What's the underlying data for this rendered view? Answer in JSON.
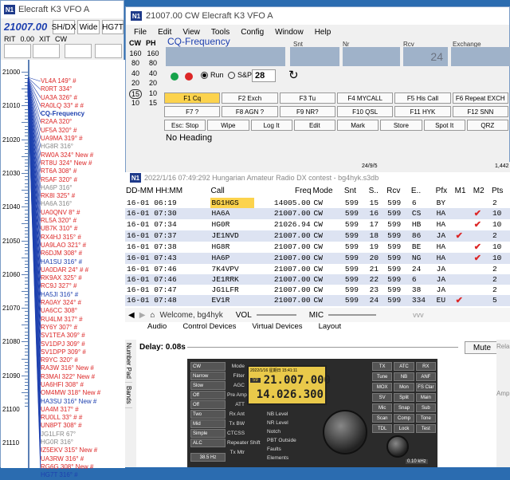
{
  "bandmap": {
    "title": "Elecraft K3 VFO A",
    "freq": "21007.00",
    "buttons": [
      "SH/DX",
      "Wide",
      "HG7T"
    ],
    "rit_label": "RIT",
    "rit_value": "0.00",
    "xit_label": "XIT",
    "xit_value": "CW",
    "scale_labels": [
      "21000",
      "21010",
      "21020",
      "21030",
      "21040",
      "21050",
      "21060",
      "21070",
      "21080",
      "21090",
      "21100",
      "21110"
    ],
    "spots": [
      {
        "text": "VL4A 149° #",
        "color": "#dc2626"
      },
      {
        "text": "R0RT 334°",
        "color": "#dc2626"
      },
      {
        "text": "UA3A 326° #",
        "color": "#dc2626"
      },
      {
        "text": "RA0LQ 33° # #",
        "color": "#dc2626"
      },
      {
        "text": "CQ-Frequency",
        "color": "#1e40af"
      },
      {
        "text": "R2AA 320°",
        "color": "#dc2626"
      },
      {
        "text": "UF5A 320° #",
        "color": "#dc2626"
      },
      {
        "text": "UA9MA 319° #",
        "color": "#dc2626"
      },
      {
        "text": "HG8R 316°",
        "color": "#888888"
      },
      {
        "text": "RW0A 324° New #",
        "color": "#dc2626"
      },
      {
        "text": "RT8U 324° New #",
        "color": "#dc2626"
      },
      {
        "text": "RT6A 308° #",
        "color": "#dc2626"
      },
      {
        "text": "R5AF 320° #",
        "color": "#dc2626"
      },
      {
        "text": "HA6P 316°",
        "color": "#888888"
      },
      {
        "text": "RK8I 325° #",
        "color": "#dc2626"
      },
      {
        "text": "HA6A 316°",
        "color": "#888888"
      },
      {
        "text": "UA0QNV 8° #",
        "color": "#dc2626"
      },
      {
        "text": "RL5A 320° #",
        "color": "#dc2626"
      },
      {
        "text": "UB7K 310° #",
        "color": "#dc2626"
      },
      {
        "text": "RX4HJ 315° #",
        "color": "#dc2626"
      },
      {
        "text": "UA9LAO 321° #",
        "color": "#dc2626"
      },
      {
        "text": "R6DJM 308° #",
        "color": "#dc2626"
      },
      {
        "text": "HA1SU 316° #",
        "color": "#1e40af"
      },
      {
        "text": "UA0DAR 24° # #",
        "color": "#dc2626"
      },
      {
        "text": "RK9AX 325° #",
        "color": "#dc2626"
      },
      {
        "text": "RC9J 327° #",
        "color": "#dc2626"
      },
      {
        "text": "HA5JI 316° #",
        "color": "#1e40af"
      },
      {
        "text": "RA0AY 324° #",
        "color": "#dc2626"
      },
      {
        "text": "UA6CC 308°",
        "color": "#dc2626"
      },
      {
        "text": "RU4LM 317° #",
        "color": "#dc2626"
      },
      {
        "text": "RY6Y 307° #",
        "color": "#dc2626"
      },
      {
        "text": "SV1TEA 309° #",
        "color": "#dc2626"
      },
      {
        "text": "SV1DPJ 309° #",
        "color": "#dc2626"
      },
      {
        "text": "SV1DPP 309° #",
        "color": "#dc2626"
      },
      {
        "text": "R9YC 320° #",
        "color": "#dc2626"
      },
      {
        "text": "RA3W 316° New #",
        "color": "#dc2626"
      },
      {
        "text": "R3MAI 322° New #",
        "color": "#dc2626"
      },
      {
        "text": "UA6HFI 308° #",
        "color": "#dc2626"
      },
      {
        "text": "OM4MW 318° New #",
        "color": "#dc2626"
      },
      {
        "text": "HA3SU 316° New #",
        "color": "#1e40af"
      },
      {
        "text": "UA4M 317° #",
        "color": "#dc2626"
      },
      {
        "text": "RU0LL 33° # #",
        "color": "#dc2626"
      },
      {
        "text": "UN8PT 308° #",
        "color": "#dc2626"
      },
      {
        "text": "JG1LFR 67°",
        "color": "#888888"
      },
      {
        "text": "HG0R 316°",
        "color": "#888888"
      },
      {
        "text": "IZ5EKV 315° New #",
        "color": "#dc2626"
      },
      {
        "text": "UA3RW 316° #",
        "color": "#dc2626"
      },
      {
        "text": "RG6G 308° New #",
        "color": "#dc2626"
      },
      {
        "text": "HG7T 316° #",
        "color": "#1e40af"
      }
    ]
  },
  "main": {
    "title": "21007.00 CW Elecraft K3 VFO A",
    "menu": [
      "File",
      "Edit",
      "View",
      "Tools",
      "Config",
      "Window",
      "Help"
    ],
    "cw_label": "CW",
    "ph_label": "PH",
    "wpm_values": [
      [
        "160",
        "160"
      ],
      [
        "80",
        "80"
      ],
      [
        "40",
        "40"
      ],
      [
        "20",
        "20"
      ],
      [
        "15",
        "10"
      ],
      [
        "10",
        "15"
      ]
    ],
    "field_labels": [
      "Snt",
      "Nr",
      "Rcv",
      "Exchange"
    ],
    "rcv_placeholder": "24",
    "cq_freq": "CQ-Frequency",
    "run_label": "Run",
    "sp_label": "S&P",
    "speed": "28",
    "fkeys_row1": [
      "F1 Cq",
      "F2 Exch",
      "F3 Tu",
      "F4 MYCALL",
      "F5 His Call",
      "F6 Repeat EXCH"
    ],
    "fkeys_row2": [
      "F7 ?",
      "F8 AGN ?",
      "F9 NR?",
      "F10 QSL",
      "F11 HYK",
      "F12 SNN"
    ],
    "fkeys_row3": [
      "Esc: Stop",
      "Wipe",
      "Log It",
      "Edit",
      "Mark",
      "Store",
      "Spot It",
      "QRZ"
    ],
    "heading": "No Heading",
    "status_qso": "24/9/5",
    "status_right": "1,442"
  },
  "log": {
    "title": "2022/1/16 07:49:292  Hungarian Amateur Radio DX contest - bg4hyk.s3db",
    "headers": [
      "DD-MM HH:MM",
      "Call",
      "Freq",
      "Mode",
      "Snt",
      "S..",
      "Rcv",
      "E..",
      "Pfx",
      "M1",
      "M2",
      "Pts"
    ],
    "rows": [
      [
        "16-01 06:19",
        "BG1HGS",
        "14005.00",
        "CW",
        "599",
        "15",
        "599",
        "6",
        "BY",
        "",
        "",
        "2"
      ],
      [
        "16-01 07:30",
        "HA6A",
        "21007.00",
        "CW",
        "599",
        "16",
        "599",
        "CS",
        "HA",
        "",
        "✔",
        "10"
      ],
      [
        "16-01 07:34",
        "HG0R",
        "21026.94",
        "CW",
        "599",
        "17",
        "599",
        "HB",
        "HA",
        "",
        "✔",
        "10"
      ],
      [
        "16-01 07:37",
        "JE1NVD",
        "21007.00",
        "CW",
        "599",
        "18",
        "599",
        "86",
        "JA",
        "✔",
        "",
        "2"
      ],
      [
        "16-01 07:38",
        "HG8R",
        "21007.00",
        "CW",
        "599",
        "19",
        "599",
        "BE",
        "HA",
        "",
        "✔",
        "10"
      ],
      [
        "16-01 07:43",
        "HA6P",
        "21007.00",
        "CW",
        "599",
        "20",
        "599",
        "NG",
        "HA",
        "",
        "✔",
        "10"
      ],
      [
        "16-01 07:46",
        "7K4VPV",
        "21007.00",
        "CW",
        "599",
        "21",
        "599",
        "24",
        "JA",
        "",
        "",
        "2"
      ],
      [
        "16-01 07:46",
        "JE1RRK",
        "21007.00",
        "CW",
        "599",
        "22",
        "599",
        "6",
        "JA",
        "",
        "",
        "2"
      ],
      [
        "16-01 07:47",
        "JG1LFR",
        "21007.00",
        "CW",
        "599",
        "23",
        "599",
        "38",
        "JA",
        "",
        "",
        "2"
      ],
      [
        "16-01 07:48",
        "EV1R",
        "21007.00",
        "CW",
        "599",
        "24",
        "599",
        "334",
        "EU",
        "✔",
        "",
        "5"
      ]
    ]
  },
  "bottom": {
    "welcome": "Welcome, bg4hyk",
    "vol_label": "VOL",
    "mic_label": "MIC",
    "vvv": "vvv",
    "tabs": [
      "Audio",
      "Control Devices",
      "Virtual Devices",
      "Layout"
    ],
    "side_tabs": [
      "Number Pad",
      "Bands"
    ],
    "delay": "Delay: 0.08s",
    "mute": "Mute",
    "right_tab1": "Rela",
    "right_tab2": "Amp",
    "radio_freq1": "21.007.000",
    "radio_freq2": "14.026.300",
    "lcd_top": "2022/1/16 星期日 15:41:11",
    "lcd_mid": "59",
    "left_btns": [
      "CW",
      "Narrow",
      "Slow",
      "Off",
      "Off",
      "Two",
      "Mid",
      "Simple",
      "ALC"
    ],
    "left_lbls": [
      "Mode",
      "Filter",
      "AGC",
      "Pre Amp",
      "ATT",
      "Rx Ant",
      "Tx BW",
      "CTCSS",
      "Repeater Shift",
      "Tx Mtr"
    ],
    "small_lbls": [
      "38.5 Hz"
    ],
    "right_btns": [
      "TX",
      "ATC",
      "RX",
      "Tune",
      "NB",
      "ANF",
      "MOX",
      "Mon",
      "FS Clar",
      "SV",
      "Split",
      "Main",
      "Mic",
      "Snap",
      "Sub",
      "Scan",
      "Comp",
      "Tone",
      "TDL",
      "Lock",
      "Test"
    ],
    "knob_lbls": [
      "NB Level",
      "NR Level",
      "Notch",
      "PBT Outside",
      "Faults",
      "Elements"
    ],
    "step": "0.10 kHz"
  }
}
